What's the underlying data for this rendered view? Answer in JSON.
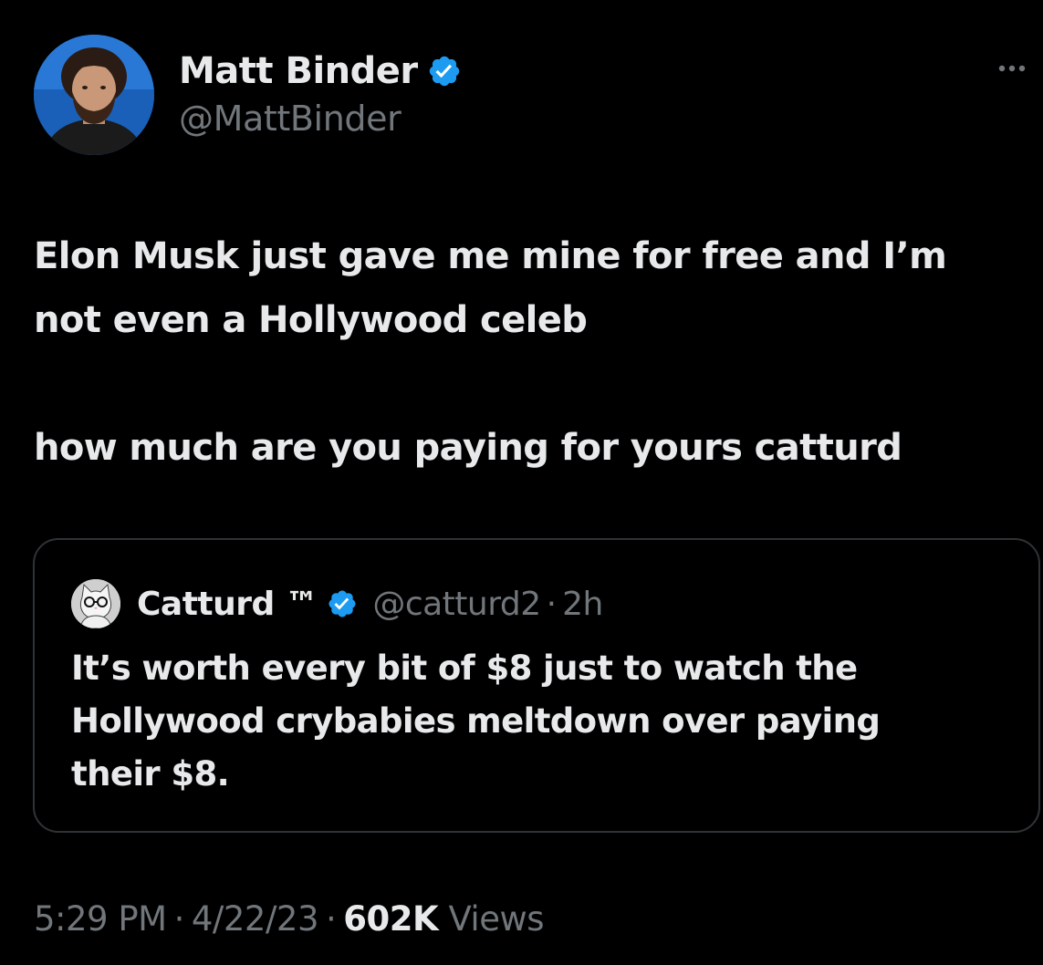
{
  "author": {
    "display_name": "Matt Binder",
    "handle": "@MattBinder",
    "verified": true,
    "avatar_icon": "user-photo-avatar"
  },
  "more_icon": "ellipsis-icon",
  "tweet": {
    "lines": [
      "Elon Musk just gave me mine for free and I’m",
      "not even a Hollywood celeb",
      "how much are you paying for yours catturd"
    ]
  },
  "quote": {
    "display_name": "Catturd ™",
    "handle": "@catturd2",
    "separator": "·",
    "time": "2h",
    "verified": true,
    "avatar_icon": "cat-avatar",
    "lines": [
      "It’s worth every bit of $8 just to watch the",
      "Hollywood crybabies meltdown over paying",
      "their $8."
    ]
  },
  "meta": {
    "time": "5:29 PM",
    "separator": "·",
    "date": "4/22/23",
    "views_count": "602K",
    "views_label": "Views"
  },
  "colors": {
    "background": "#000000",
    "text": "#e7e9ea",
    "secondary_text": "#71767b",
    "verified_blue": "#1d9bf0",
    "border": "#2f3336"
  }
}
